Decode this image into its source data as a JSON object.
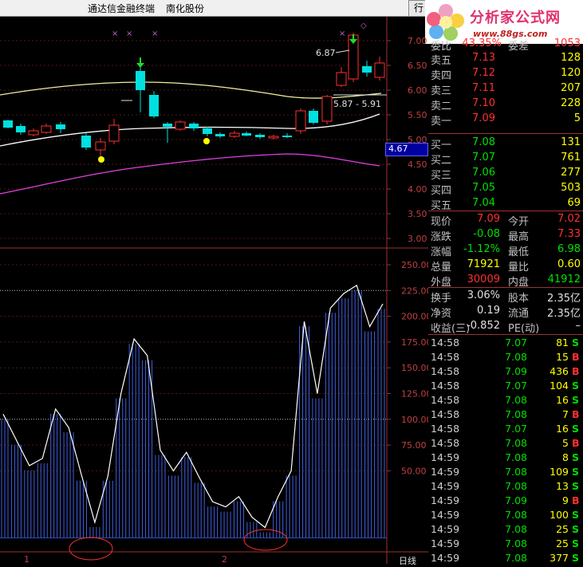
{
  "app": {
    "title": "通达信金融终端",
    "stock_name": "南化股份",
    "tab_label": "行"
  },
  "logo": {
    "name": "分析家公式网",
    "url": "www.88gs.com"
  },
  "price_chart": {
    "y_ticks": [
      "7.00",
      "6.50",
      "6.00",
      "5.50",
      "5.00",
      "4.50",
      "4.00",
      "3.50",
      "3.00"
    ],
    "annotation_high": "6.87",
    "annotation_range": "5.87 - 5.91",
    "cursor_price": "4.67",
    "markers": [
      "×",
      "×",
      "×",
      "×",
      "×"
    ]
  },
  "indicator_chart": {
    "y_ticks": [
      "250.00",
      "225.00",
      "200.00",
      "175.00",
      "150.00",
      "125.00",
      "100.00",
      "75.00",
      "50.00"
    ],
    "values": [
      105,
      80,
      55,
      62,
      110,
      92,
      45,
      0,
      45,
      125,
      178,
      162,
      70,
      50,
      68,
      43,
      20,
      15,
      25,
      5,
      -5,
      25,
      50,
      195,
      125,
      208,
      222,
      230,
      190,
      212
    ]
  },
  "bottom_axis": {
    "label1": "1",
    "label2": "2",
    "period": "日线"
  },
  "quote": {
    "header": {
      "label1": "委比",
      "val1": "43.35%",
      "label2": "委差",
      "val2": "1053"
    },
    "asks": [
      {
        "label": "卖五",
        "price": "7.13",
        "vol": "128"
      },
      {
        "label": "卖四",
        "price": "7.12",
        "vol": "120"
      },
      {
        "label": "卖三",
        "price": "7.11",
        "vol": "207"
      },
      {
        "label": "卖二",
        "price": "7.10",
        "vol": "228"
      },
      {
        "label": "卖一",
        "price": "7.09",
        "vol": "5"
      }
    ],
    "bids": [
      {
        "label": "买一",
        "price": "7.08",
        "vol": "131"
      },
      {
        "label": "买二",
        "price": "7.07",
        "vol": "761"
      },
      {
        "label": "买三",
        "price": "7.06",
        "vol": "277"
      },
      {
        "label": "买四",
        "price": "7.05",
        "vol": "503"
      },
      {
        "label": "买五",
        "price": "7.04",
        "vol": "69"
      }
    ],
    "stats": [
      {
        "l1": "现价",
        "v1": "7.09",
        "c1": "red",
        "l2": "今开",
        "v2": "7.02",
        "c2": "red"
      },
      {
        "l1": "涨跌",
        "v1": "-0.08",
        "c1": "green",
        "l2": "最高",
        "v2": "7.33",
        "c2": "red"
      },
      {
        "l1": "涨幅",
        "v1": "-1.12%",
        "c1": "green",
        "l2": "最低",
        "v2": "6.98",
        "c2": "green"
      },
      {
        "l1": "总量",
        "v1": "71921",
        "c1": "yellow",
        "l2": "量比",
        "v2": "0.60",
        "c2": "yellow"
      },
      {
        "l1": "外盘",
        "v1": "30009",
        "c1": "red",
        "l2": "内盘",
        "v2": "41912",
        "c2": "green"
      }
    ],
    "stats2": [
      {
        "l1": "换手",
        "v1": "3.06%",
        "l2": "股本",
        "v2": "2.35亿"
      },
      {
        "l1": "净资",
        "v1": "0.19",
        "l2": "流通",
        "v2": "2.35亿"
      },
      {
        "l1": "收益(三)",
        "v1": "-0.852",
        "l2": "PE(动)",
        "v2": "–"
      }
    ]
  },
  "ticks": [
    {
      "time": "14:58",
      "price": "7.07",
      "pc": "green",
      "vol": "81",
      "bs": "S"
    },
    {
      "time": "14:58",
      "price": "7.08",
      "pc": "green",
      "vol": "15",
      "bs": "B"
    },
    {
      "time": "14:58",
      "price": "7.09",
      "pc": "green",
      "vol": "436",
      "bs": "B"
    },
    {
      "time": "14:58",
      "price": "7.07",
      "pc": "green",
      "vol": "104",
      "bs": "S"
    },
    {
      "time": "14:58",
      "price": "7.08",
      "pc": "green",
      "vol": "16",
      "bs": "S"
    },
    {
      "time": "14:58",
      "price": "7.08",
      "pc": "green",
      "vol": "7",
      "bs": "B"
    },
    {
      "time": "14:58",
      "price": "7.07",
      "pc": "green",
      "vol": "16",
      "bs": "S"
    },
    {
      "time": "14:58",
      "price": "7.08",
      "pc": "green",
      "vol": "5",
      "bs": "B"
    },
    {
      "time": "14:59",
      "price": "7.08",
      "pc": "green",
      "vol": "8",
      "bs": "S"
    },
    {
      "time": "14:59",
      "price": "7.08",
      "pc": "green",
      "vol": "109",
      "bs": "S"
    },
    {
      "time": "14:59",
      "price": "7.08",
      "pc": "green",
      "vol": "13",
      "bs": "S"
    },
    {
      "time": "14:59",
      "price": "7.09",
      "pc": "green",
      "vol": "9",
      "bs": "B"
    },
    {
      "time": "14:59",
      "price": "7.08",
      "pc": "green",
      "vol": "100",
      "bs": "S"
    },
    {
      "time": "14:59",
      "price": "7.08",
      "pc": "green",
      "vol": "25",
      "bs": "S"
    },
    {
      "time": "14:59",
      "price": "7.08",
      "pc": "green",
      "vol": "25",
      "bs": "S"
    },
    {
      "time": "14:59",
      "price": "7.08",
      "pc": "green",
      "vol": "377",
      "bs": "S"
    }
  ],
  "colors": {
    "up": "#ff3030",
    "down": "#00e0e0",
    "buy": "#ff3030",
    "sell": "#00e000",
    "border": "#a03030"
  }
}
